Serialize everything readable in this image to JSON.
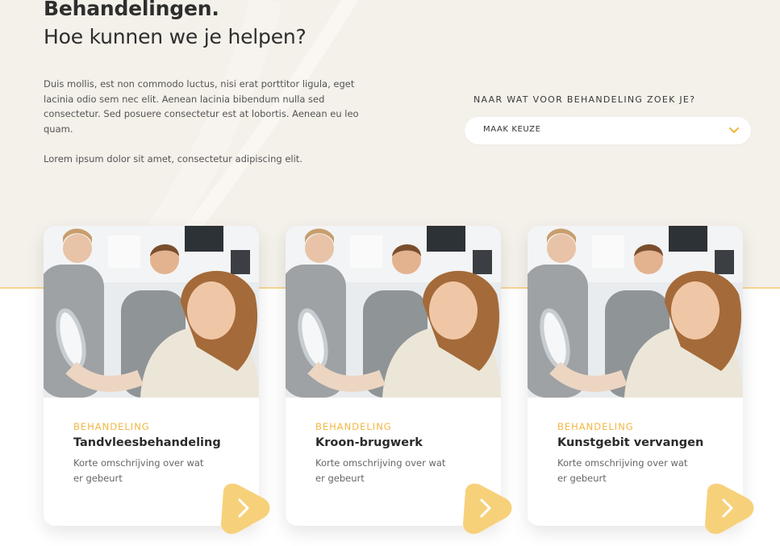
{
  "header": {
    "title": "Behandelingen.",
    "subtitle": "Hoe kunnen we je helpen?",
    "intro": "Duis mollis, est non commodo luctus, nisi erat porttitor ligula, eget lacinia odio sem nec elit. Aenean lacinia bibendum nulla sed consectetur. Sed posuere consectetur est at lobortis. Aenean eu leo quam.",
    "intro2": "Lorem ipsum dolor sit amet, consectetur adipiscing elit."
  },
  "filter": {
    "label": "NAAR WAT VOOR BEHANDELING ZOEK JE?",
    "selected": "MAAK KEUZE",
    "icon": "chevron-down-icon"
  },
  "colors": {
    "accent": "#f0b742",
    "button": "#f7d17a",
    "hero_bg": "#f4f0ea"
  },
  "cards": [
    {
      "kicker": "BEHANDELING",
      "title": "Tandvleesbehandeling",
      "description": "Korte omschrijving over wat er gebeurt",
      "icon": "arrow-right-icon"
    },
    {
      "kicker": "BEHANDELING",
      "title": "Kroon-brugwerk",
      "description": "Korte omschrijving over wat er gebeurt",
      "icon": "arrow-right-icon"
    },
    {
      "kicker": "BEHANDELING",
      "title": "Kunstgebit vervangen",
      "description": "Korte omschrijving over wat er gebeurt",
      "icon": "arrow-right-icon"
    }
  ]
}
